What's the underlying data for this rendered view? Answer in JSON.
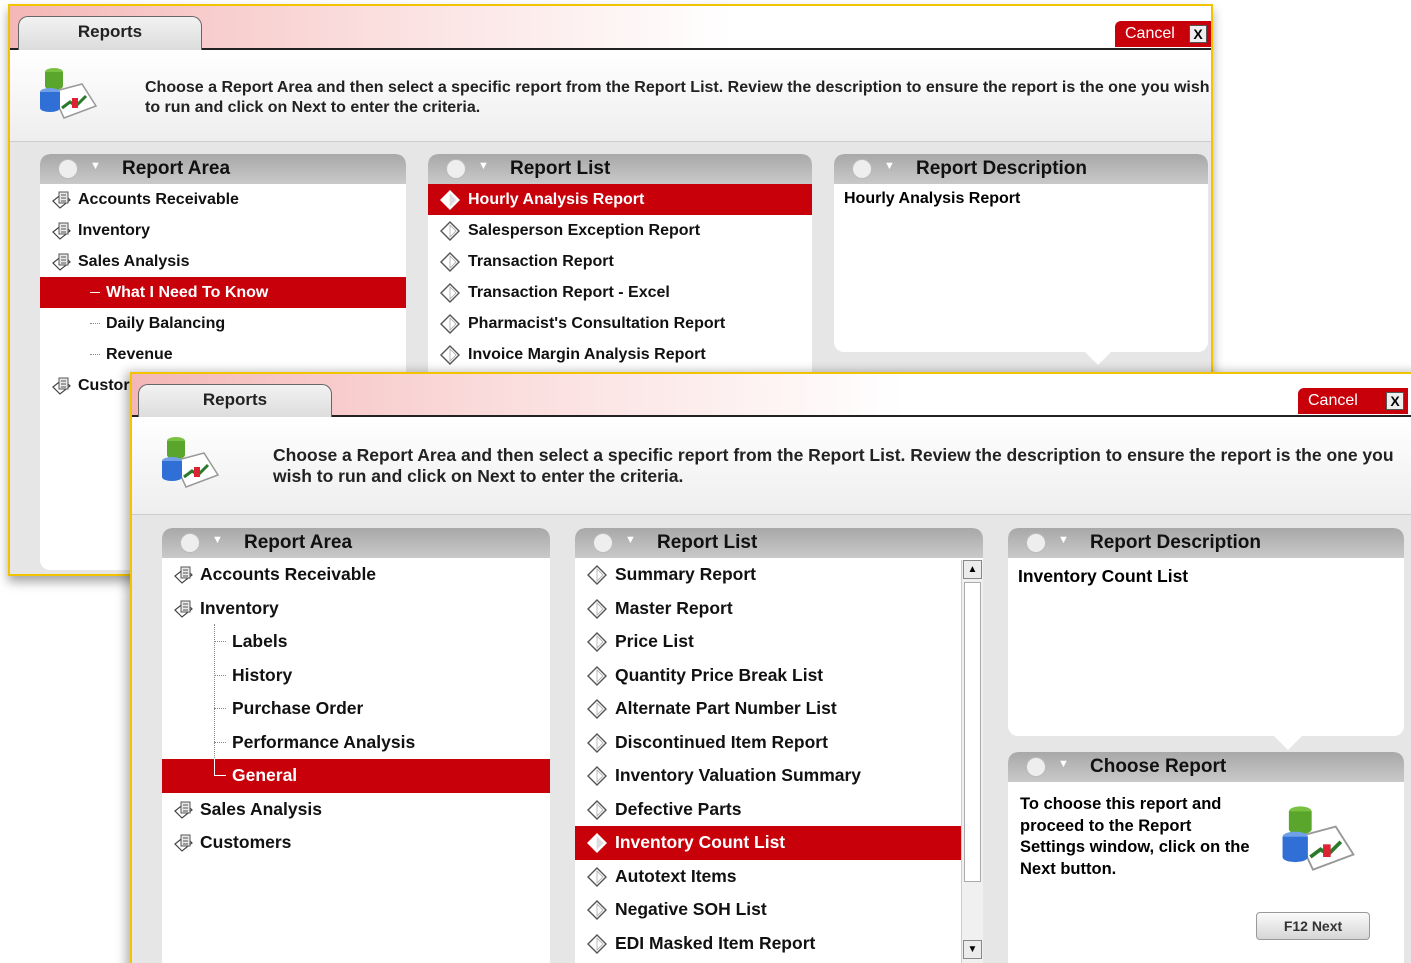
{
  "back_window": {
    "tab": "Reports",
    "cancel_label": "Cancel",
    "close_glyph": "X",
    "instruction": "Choose a Report Area and then select a specific report from the Report List. Review the description to ensure the report is the one you wish to run and click on Next to enter the criteria.",
    "report_area": {
      "title": "Report Area",
      "items": [
        {
          "label": "Accounts Receivable"
        },
        {
          "label": "Inventory"
        },
        {
          "label": "Sales Analysis"
        },
        {
          "label": "What I Need To Know"
        },
        {
          "label": "Daily Balancing"
        },
        {
          "label": "Revenue"
        },
        {
          "label": "Custor"
        }
      ]
    },
    "report_list": {
      "title": "Report List",
      "items": [
        {
          "label": "Hourly Analysis Report"
        },
        {
          "label": "Salesperson Exception Report"
        },
        {
          "label": "Transaction Report"
        },
        {
          "label": "Transaction Report - Excel"
        },
        {
          "label": "Pharmacist's Consultation Report"
        },
        {
          "label": "Invoice Margin Analysis Report"
        }
      ]
    },
    "report_description": {
      "title": "Report Description",
      "text": "Hourly Analysis Report"
    }
  },
  "front_window": {
    "tab": "Reports",
    "cancel_label": "Cancel",
    "close_glyph": "X",
    "instruction": "Choose a Report Area and then select a specific report from the Report List. Review the description to ensure the report is the one you wish to run and click on Next to enter the criteria.",
    "report_area": {
      "title": "Report Area",
      "items": [
        {
          "label": "Accounts Receivable"
        },
        {
          "label": "Inventory"
        },
        {
          "label": "Labels"
        },
        {
          "label": "History"
        },
        {
          "label": "Purchase Order"
        },
        {
          "label": "Performance Analysis"
        },
        {
          "label": "General"
        },
        {
          "label": "Sales Analysis"
        },
        {
          "label": "Customers"
        }
      ]
    },
    "report_list": {
      "title": "Report List",
      "items": [
        {
          "label": "Summary Report"
        },
        {
          "label": "Master Report"
        },
        {
          "label": "Price List"
        },
        {
          "label": "Quantity Price Break List"
        },
        {
          "label": "Alternate Part Number List"
        },
        {
          "label": "Discontinued Item Report"
        },
        {
          "label": "Inventory Valuation Summary"
        },
        {
          "label": "Defective Parts"
        },
        {
          "label": "Inventory Count List"
        },
        {
          "label": "Autotext Items"
        },
        {
          "label": "Negative SOH List"
        },
        {
          "label": "EDI Masked Item Report"
        }
      ]
    },
    "report_description": {
      "title": "Report Description",
      "text": "Inventory Count List"
    },
    "choose_report": {
      "title": "Choose Report",
      "text": "To choose this report and proceed to the Report Settings window, click on the Next button.",
      "next_label": "F12  Next"
    }
  },
  "colors": {
    "selection": "#c8000a",
    "frame": "#f2c300",
    "panel_header": "#b3b3b3"
  }
}
